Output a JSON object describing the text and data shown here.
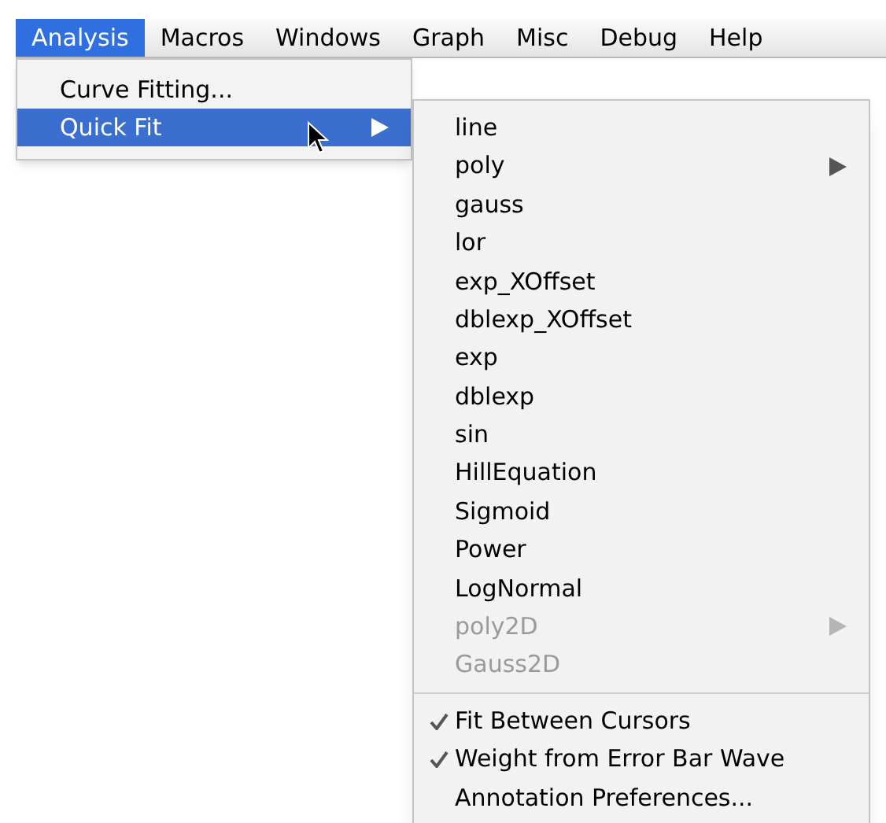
{
  "menubar": [
    {
      "label": "Analysis",
      "selected": true
    },
    {
      "label": "Macros",
      "selected": false
    },
    {
      "label": "Windows",
      "selected": false
    },
    {
      "label": "Graph",
      "selected": false
    },
    {
      "label": "Misc",
      "selected": false
    },
    {
      "label": "Debug",
      "selected": false
    },
    {
      "label": "Help",
      "selected": false
    }
  ],
  "analysis_menu": [
    {
      "label": "Curve Fitting...",
      "selected": false,
      "submenu": false
    },
    {
      "label": "Quick Fit",
      "selected": true,
      "submenu": true
    }
  ],
  "quick_fit_menu": [
    {
      "kind": "item",
      "label": "line",
      "checked": false,
      "disabled": false,
      "submenu": false
    },
    {
      "kind": "item",
      "label": "poly",
      "checked": false,
      "disabled": false,
      "submenu": true
    },
    {
      "kind": "item",
      "label": "gauss",
      "checked": false,
      "disabled": false,
      "submenu": false
    },
    {
      "kind": "item",
      "label": "lor",
      "checked": false,
      "disabled": false,
      "submenu": false
    },
    {
      "kind": "item",
      "label": "exp_XOffset",
      "checked": false,
      "disabled": false,
      "submenu": false
    },
    {
      "kind": "item",
      "label": "dblexp_XOffset",
      "checked": false,
      "disabled": false,
      "submenu": false
    },
    {
      "kind": "item",
      "label": "exp",
      "checked": false,
      "disabled": false,
      "submenu": false
    },
    {
      "kind": "item",
      "label": "dblexp",
      "checked": false,
      "disabled": false,
      "submenu": false
    },
    {
      "kind": "item",
      "label": "sin",
      "checked": false,
      "disabled": false,
      "submenu": false
    },
    {
      "kind": "item",
      "label": "HillEquation",
      "checked": false,
      "disabled": false,
      "submenu": false
    },
    {
      "kind": "item",
      "label": "Sigmoid",
      "checked": false,
      "disabled": false,
      "submenu": false
    },
    {
      "kind": "item",
      "label": "Power",
      "checked": false,
      "disabled": false,
      "submenu": false
    },
    {
      "kind": "item",
      "label": "LogNormal",
      "checked": false,
      "disabled": false,
      "submenu": false
    },
    {
      "kind": "item",
      "label": "poly2D",
      "checked": false,
      "disabled": true,
      "submenu": true
    },
    {
      "kind": "item",
      "label": "Gauss2D",
      "checked": false,
      "disabled": true,
      "submenu": false
    },
    {
      "kind": "separator"
    },
    {
      "kind": "item",
      "label": "Fit Between Cursors",
      "checked": true,
      "disabled": false,
      "submenu": false
    },
    {
      "kind": "item",
      "label": "Weight from Error Bar Wave",
      "checked": true,
      "disabled": false,
      "submenu": false
    },
    {
      "kind": "item",
      "label": "Annotation Preferences...",
      "checked": false,
      "disabled": false,
      "submenu": false
    }
  ]
}
